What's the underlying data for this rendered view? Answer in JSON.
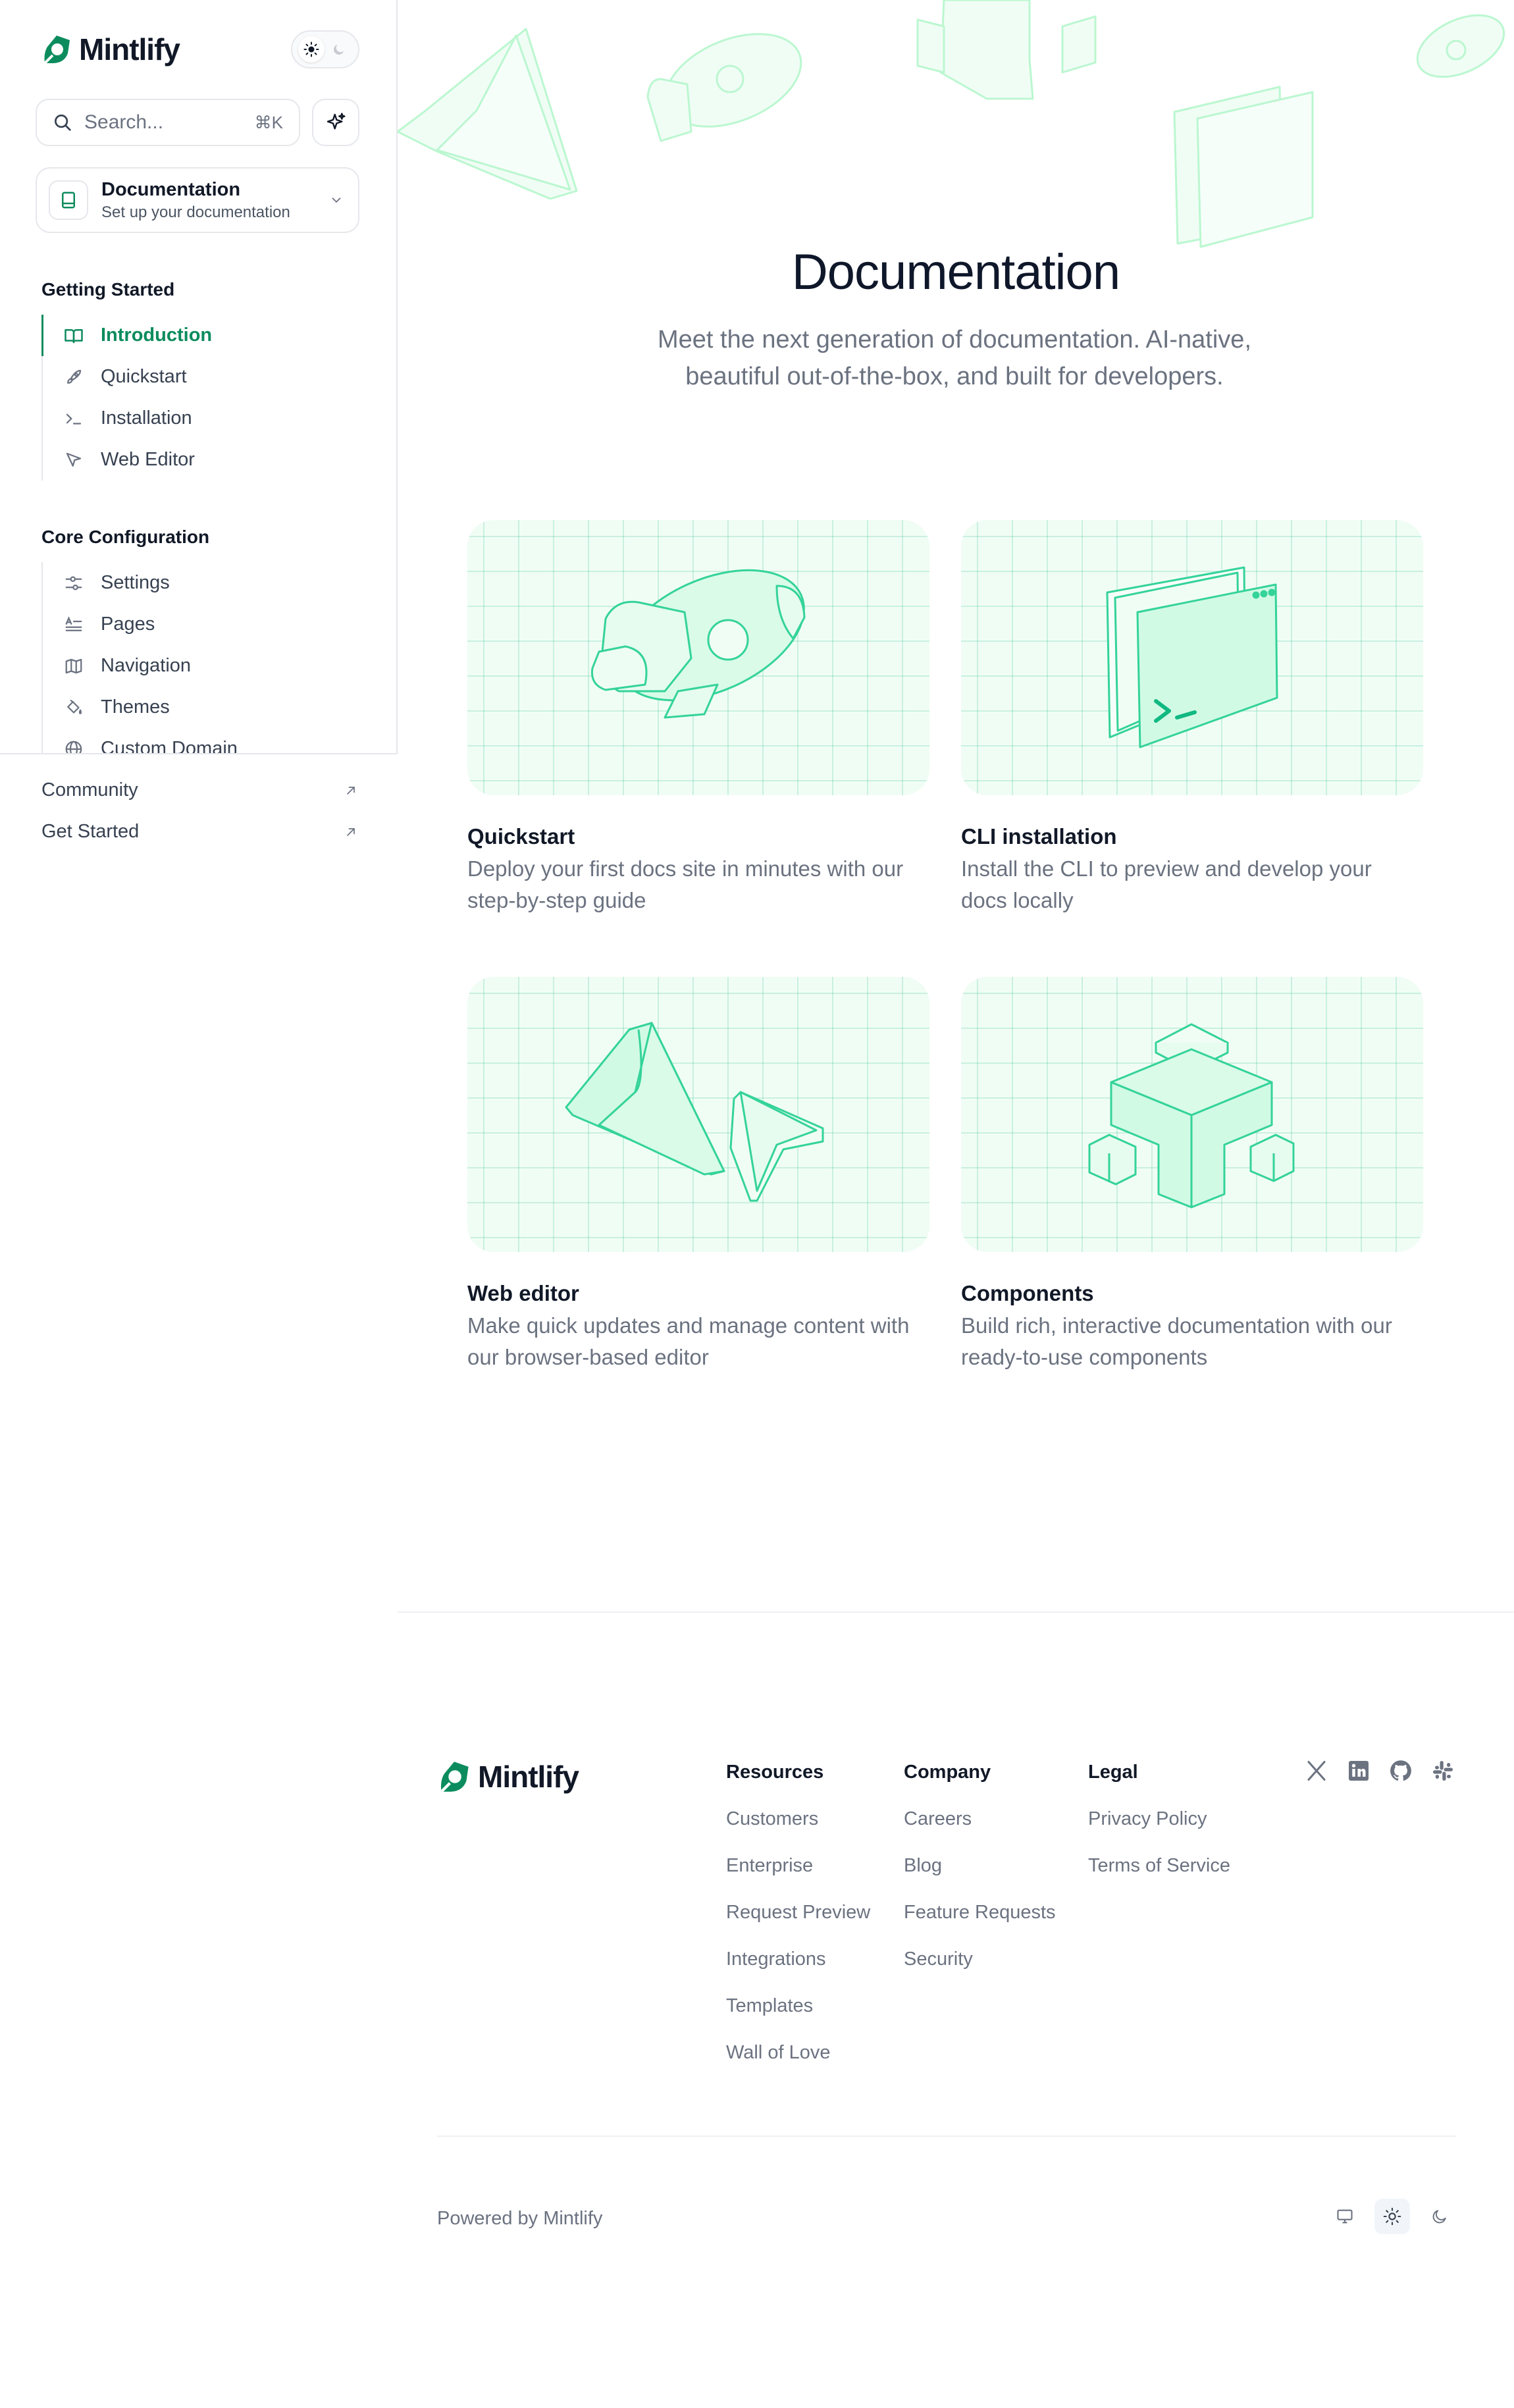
{
  "brand": {
    "name": "Mintlify",
    "accent": "#0c8c5e",
    "mint": "#10b981"
  },
  "sidebar": {
    "search": {
      "placeholder": "Search...",
      "shortcut": "⌘K"
    },
    "doc_selector": {
      "title": "Documentation",
      "subtitle": "Set up your documentation"
    },
    "groups": [
      {
        "title": "Getting Started",
        "items": [
          {
            "label": "Introduction",
            "icon": "book-open-icon",
            "active": true
          },
          {
            "label": "Quickstart",
            "icon": "rocket-icon"
          },
          {
            "label": "Installation",
            "icon": "terminal-icon"
          },
          {
            "label": "Web Editor",
            "icon": "cursor-icon"
          }
        ]
      },
      {
        "title": "Core Configuration",
        "items": [
          {
            "label": "Settings",
            "icon": "sliders-icon"
          },
          {
            "label": "Pages",
            "icon": "text-align-icon"
          },
          {
            "label": "Navigation",
            "icon": "map-icon"
          },
          {
            "label": "Themes",
            "icon": "paint-bucket-icon"
          },
          {
            "label": "Custom Domain",
            "icon": "globe-icon"
          }
        ]
      }
    ],
    "links": [
      {
        "label": "Community",
        "icon": "arrow-up-right-icon"
      },
      {
        "label": "Get Started",
        "icon": "arrow-up-right-icon"
      }
    ]
  },
  "hero": {
    "title": "Documentation",
    "subtitle": "Meet the next generation of documentation. AI-native, beautiful out-of-the-box, and built for developers."
  },
  "cards": [
    {
      "title": "Quickstart",
      "desc": "Deploy your first docs site in minutes with our step-by-step guide",
      "icon": "rocket-illustration"
    },
    {
      "title": "CLI installation",
      "desc": "Install the CLI to preview and develop your docs locally",
      "icon": "terminal-window-illustration"
    },
    {
      "title": "Web editor",
      "desc": "Make quick updates and manage content with our browser-based editor",
      "icon": "cursor-illustration"
    },
    {
      "title": "Components",
      "desc": "Build rich, interactive documentation with our ready-to-use components",
      "icon": "blocks-illustration"
    }
  ],
  "footer": {
    "columns": [
      {
        "heading": "Resources",
        "links": [
          "Customers",
          "Enterprise",
          "Request Preview",
          "Integrations",
          "Templates",
          "Wall of Love"
        ]
      },
      {
        "heading": "Company",
        "links": [
          "Careers",
          "Blog",
          "Feature Requests",
          "Security"
        ]
      },
      {
        "heading": "Legal",
        "links": [
          "Privacy Policy",
          "Terms of Service"
        ]
      }
    ],
    "socials": [
      "x-icon",
      "linkedin-icon",
      "github-icon",
      "slack-icon"
    ],
    "powered_by": "Powered by Mintlify",
    "modes": [
      "monitor-icon",
      "sun-icon",
      "moon-icon"
    ],
    "active_mode": "sun-icon"
  }
}
